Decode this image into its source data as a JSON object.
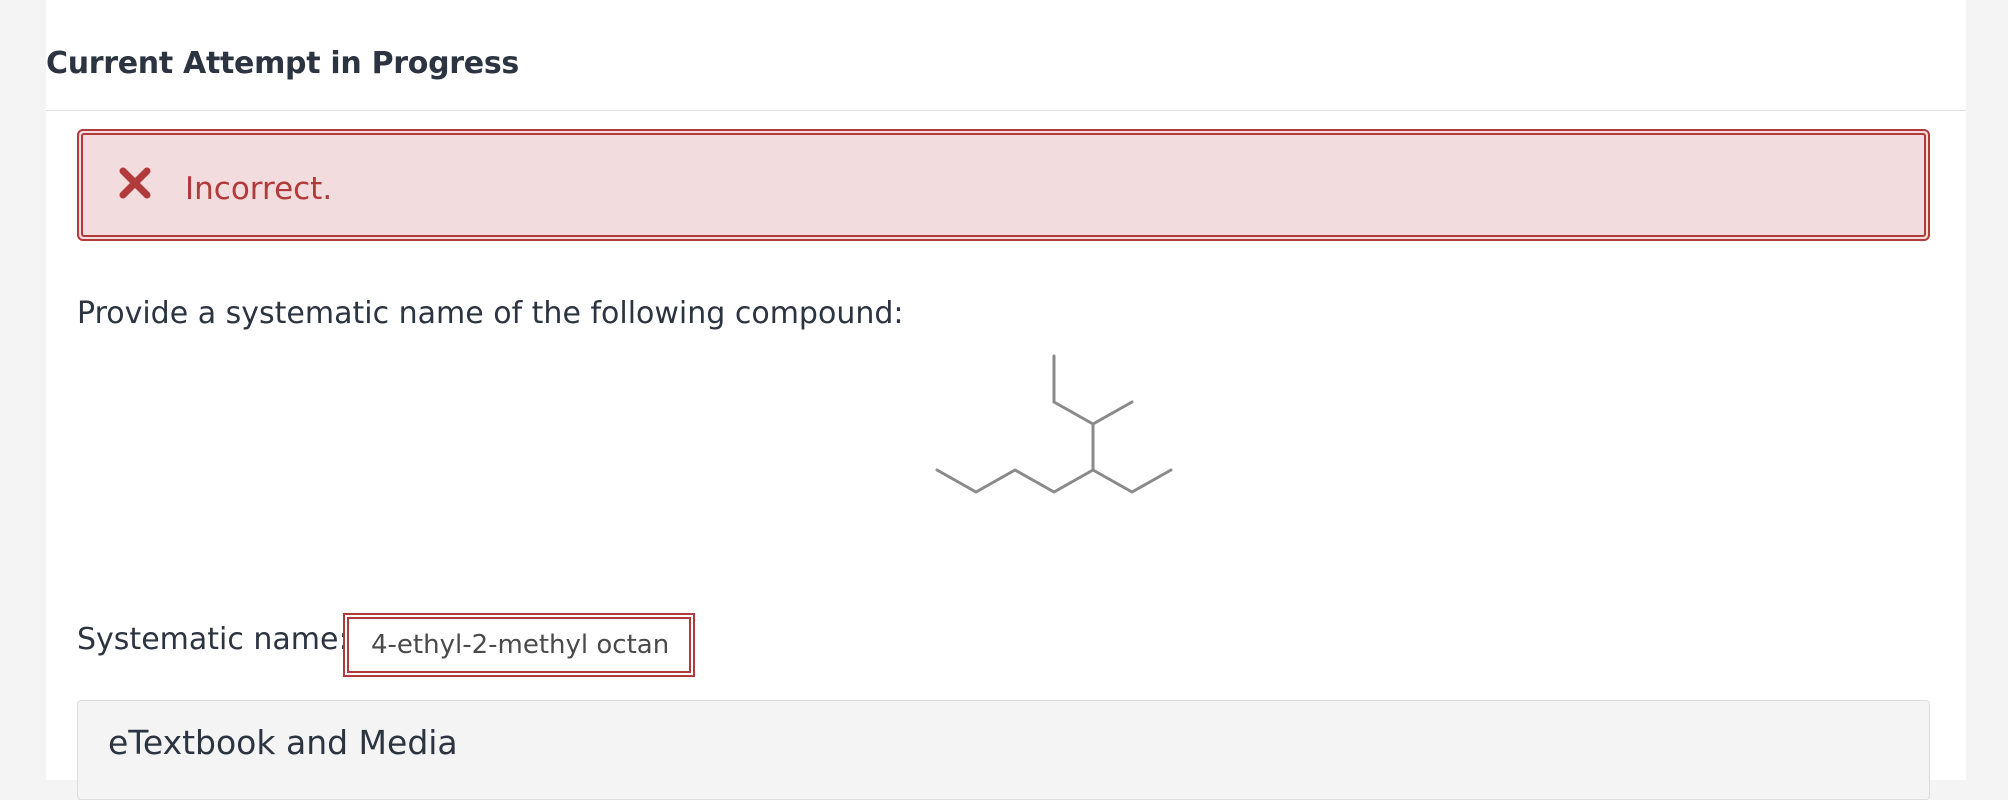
{
  "attempt": {
    "title": "Current Attempt in Progress"
  },
  "feedback": {
    "status_text": "Incorrect.",
    "icon": "close-icon",
    "color": "#b13a3a",
    "background": "#f3dcdd"
  },
  "question": {
    "prompt": "Provide a systematic name of the following compound:"
  },
  "answer": {
    "label": "Systematic name:",
    "value": "4-ethyl-2-methyl octane"
  },
  "resources": {
    "title": "eTextbook and Media"
  }
}
